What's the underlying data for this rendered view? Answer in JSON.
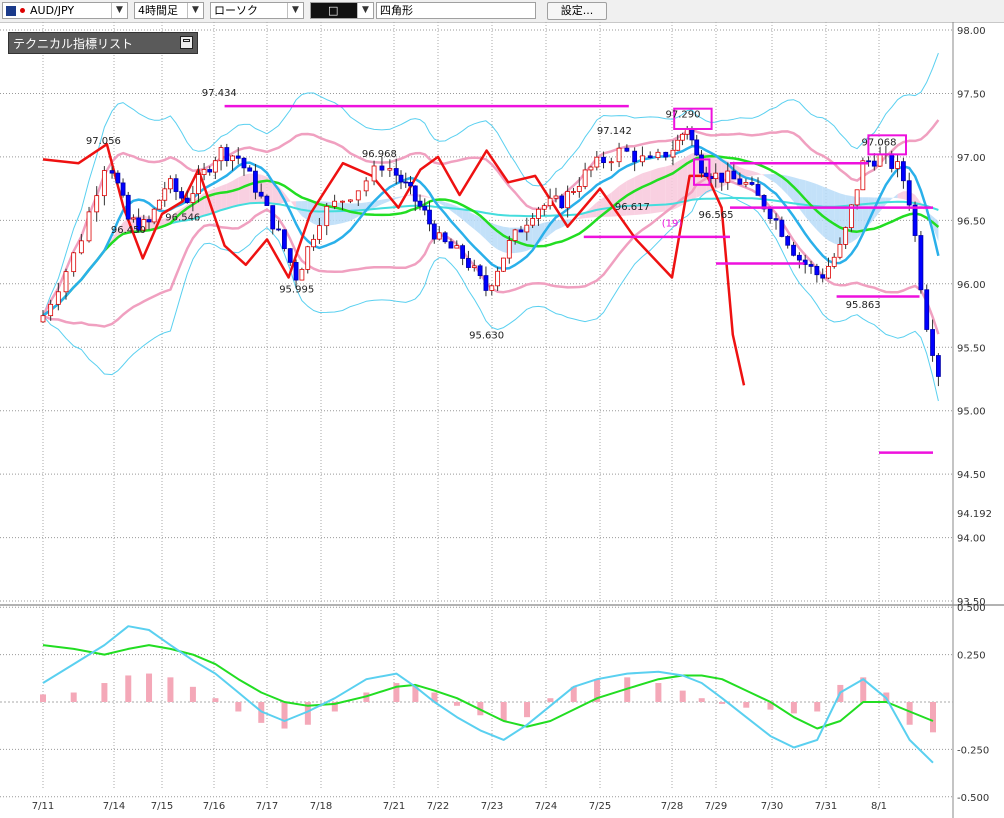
{
  "toolbar": {
    "symbol": "AUD/JPY",
    "timeframe": "4時間足",
    "chart_style": "ローソク",
    "draw_tool": "□",
    "shape_type": "四角形",
    "settings_label": "設定..."
  },
  "indicator_panel": {
    "title": "テクニカル指標リスト"
  },
  "colors": {
    "bull_candle": "#ffffff",
    "bear_candle": "#0000ff",
    "ma_short": "#2ab0ea",
    "ma_mid": "#22dd22",
    "ma_long": "#44dddd",
    "bb_outer": "#5ad0f0",
    "bb_band": "#f0a0c0",
    "cloud": "#b8dcf8",
    "cloud_alt": "#f8c8dc",
    "red_line": "#ee1111",
    "magenta": "#ee11dd",
    "macd_hist": "#f4a8b8"
  },
  "chart_data": {
    "type": "candlestick",
    "y_ticks": [
      "98.00",
      "97.50",
      "97.00",
      "96.50",
      "96.00",
      "95.50",
      "95.00",
      "94.50",
      "94.00",
      "93.50"
    ],
    "current_price": "94.192",
    "x_ticks": [
      "7/11",
      "7/14",
      "7/15",
      "7/16",
      "7/17",
      "7/18",
      "7/21",
      "7/22",
      "7/23",
      "7/24",
      "7/25",
      "7/28",
      "7/29",
      "7/30",
      "7/31",
      "8/1"
    ],
    "ylim": [
      93.5,
      98.0
    ],
    "annotations": [
      {
        "text": "97.434",
        "x": 3.1,
        "y": 97.48
      },
      {
        "text": "97.056",
        "x": 0.85,
        "y": 97.1
      },
      {
        "text": "96.450",
        "x": 1.3,
        "y": 96.4
      },
      {
        "text": "96.546",
        "x": 2.4,
        "y": 96.5
      },
      {
        "text": "95.995",
        "x": 4.55,
        "y": 95.93
      },
      {
        "text": "96.968",
        "x": 5.8,
        "y": 97.0
      },
      {
        "text": "95.630",
        "x": 7.9,
        "y": 95.57
      },
      {
        "text": "97.142",
        "x": 10.2,
        "y": 97.18
      },
      {
        "text": "97.290",
        "x": 11.25,
        "y": 97.31
      },
      {
        "text": "96.617",
        "x": 10.45,
        "y": 96.58
      },
      {
        "text": "(19)",
        "x": 11.0,
        "y": 96.45
      },
      {
        "text": "96.565",
        "x": 12.0,
        "y": 96.52
      },
      {
        "text": "97.068",
        "x": 15.0,
        "y": 97.09
      },
      {
        "text": "95.863",
        "x": 14.7,
        "y": 95.81
      }
    ],
    "magenta_rectangles": [
      {
        "x0": 11.05,
        "x1": 11.9,
        "y0": 97.22,
        "y1": 97.38
      },
      {
        "x0": 14.8,
        "x1": 15.5,
        "y0": 97.02,
        "y1": 97.17
      },
      {
        "x0": 11.5,
        "x1": 11.85,
        "y0": 96.78,
        "y1": 96.98
      }
    ],
    "magenta_hlines": [
      {
        "x0": 3.2,
        "x1": 10.4,
        "y": 97.4
      },
      {
        "x0": 9.7,
        "x1": 12.25,
        "y": 96.37
      },
      {
        "x0": 12.25,
        "x1": 14.8,
        "y": 96.95
      },
      {
        "x0": 12.25,
        "x1": 16.0,
        "y": 96.6
      },
      {
        "x0": 12.0,
        "x1": 13.6,
        "y": 96.16
      },
      {
        "x0": 14.2,
        "x1": 15.75,
        "y": 95.9
      },
      {
        "x0": 15.0,
        "x1": 16.0,
        "y": 94.67
      }
    ],
    "macd": {
      "y_ticks": [
        "0.500",
        "0.250",
        "-0.250",
        "-0.500"
      ],
      "ylim": [
        -0.5,
        0.5
      ],
      "hist": [
        0.04,
        0.05,
        0.1,
        0.14,
        0.15,
        0.13,
        0.08,
        0.02,
        -0.05,
        -0.11,
        -0.14,
        -0.12,
        -0.05,
        0.05,
        0.1,
        0.09,
        0.05,
        -0.02,
        -0.07,
        -0.1,
        -0.08,
        0.02,
        0.08,
        0.12,
        0.13,
        0.1,
        0.06,
        0.02,
        -0.01,
        -0.03,
        -0.04,
        -0.06,
        -0.05,
        0.09,
        0.13,
        0.05,
        -0.12,
        -0.16
      ],
      "macd_line": [
        0.1,
        0.2,
        0.3,
        0.4,
        0.38,
        0.3,
        0.22,
        0.15,
        0.05,
        -0.05,
        -0.1,
        -0.05,
        0.02,
        0.12,
        0.15,
        0.08,
        0.0,
        -0.08,
        -0.15,
        -0.2,
        -0.12,
        -0.02,
        0.08,
        0.12,
        0.15,
        0.16,
        0.14,
        0.1,
        0.02,
        -0.08,
        -0.18,
        -0.24,
        -0.2,
        0.05,
        0.12,
        0.02,
        -0.2,
        -0.32
      ],
      "signal_line": [
        0.3,
        0.28,
        0.25,
        0.28,
        0.3,
        0.28,
        0.25,
        0.2,
        0.12,
        0.05,
        0.0,
        -0.02,
        -0.01,
        0.03,
        0.08,
        0.09,
        0.06,
        0.02,
        -0.04,
        -0.1,
        -0.13,
        -0.1,
        -0.04,
        0.02,
        0.07,
        0.12,
        0.14,
        0.14,
        0.12,
        0.06,
        0.0,
        -0.08,
        -0.14,
        -0.1,
        0.0,
        0.0,
        -0.05,
        -0.1
      ]
    }
  }
}
